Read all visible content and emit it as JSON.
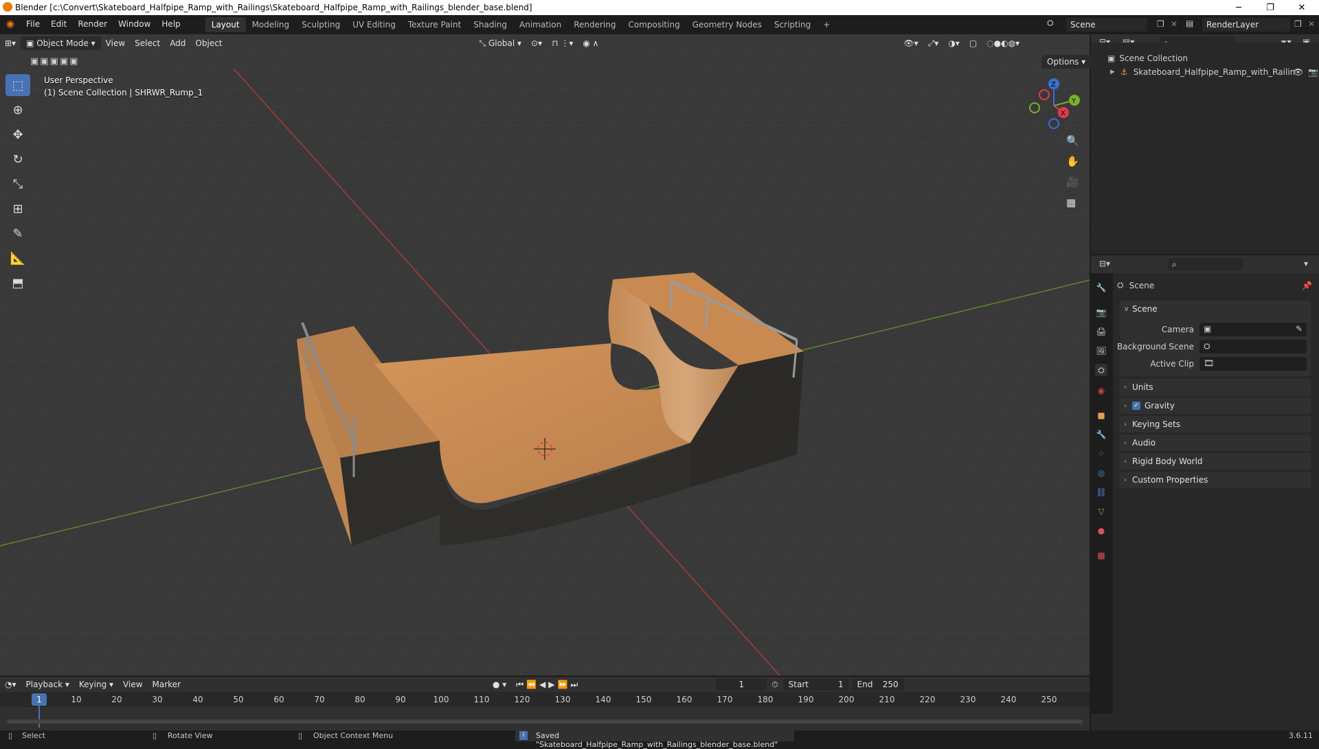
{
  "window": {
    "title": "Blender [c:\\Convert\\Skateboard_Halfpipe_Ramp_with_Railings\\Skateboard_Halfpipe_Ramp_with_Railings_blender_base.blend]",
    "controls": {
      "minimize": "─",
      "restore": "❐",
      "close": "✕"
    }
  },
  "menu": {
    "items": [
      "File",
      "Edit",
      "Render",
      "Window",
      "Help"
    ],
    "workspaces": [
      "Layout",
      "Modeling",
      "Sculpting",
      "UV Editing",
      "Texture Paint",
      "Shading",
      "Animation",
      "Rendering",
      "Compositing",
      "Geometry Nodes",
      "Scripting"
    ],
    "active_workspace": "Layout",
    "add_tab": "+",
    "scene_name": "Scene",
    "view_layer": "RenderLayer"
  },
  "viewport": {
    "mode": "Object Mode",
    "menus": [
      "View",
      "Select",
      "Add",
      "Object"
    ],
    "transform_orientation": "Global",
    "options_label": "Options",
    "overlay_line1": "User Perspective",
    "overlay_line2": "(1) Scene Collection | SHRWR_Rump_1",
    "gizmo": {
      "x": "X",
      "y": "Y",
      "z": "Z"
    },
    "colors": {
      "background": "#393939",
      "x_axis": "#a83a3a",
      "y_axis": "#5f8a2a",
      "ramp_wood": "#c98a52",
      "ramp_side": "#2f2d2a"
    }
  },
  "outliner": {
    "root": "Scene Collection",
    "items": [
      {
        "name": "Skateboard_Halfpipe_Ramp_with_Railin"
      }
    ]
  },
  "properties": {
    "header": "Scene",
    "section": "Scene",
    "fields": [
      {
        "label": "Camera",
        "value": ""
      },
      {
        "label": "Background Scene",
        "value": ""
      },
      {
        "label": "Active Clip",
        "value": ""
      }
    ],
    "panels": [
      {
        "label": "Units",
        "checkbox": false
      },
      {
        "label": "Gravity",
        "checkbox": true
      },
      {
        "label": "Keying Sets",
        "checkbox": false
      },
      {
        "label": "Audio",
        "checkbox": false
      },
      {
        "label": "Rigid Body World",
        "checkbox": false
      },
      {
        "label": "Custom Properties",
        "checkbox": false
      }
    ]
  },
  "timeline": {
    "menus": [
      "Playback",
      "Keying",
      "View",
      "Marker"
    ],
    "current_frame": "1",
    "start_label": "Start",
    "start": "1",
    "end_label": "End",
    "end": "250",
    "ticks": [
      "10",
      "20",
      "30",
      "40",
      "50",
      "60",
      "70",
      "80",
      "90",
      "100",
      "110",
      "120",
      "130",
      "140",
      "150",
      "160",
      "170",
      "180",
      "190",
      "200",
      "210",
      "220",
      "230",
      "240",
      "250"
    ],
    "playhead": "1"
  },
  "statusbar": {
    "select": "Select",
    "rotate": "Rotate View",
    "context": "Object Context Menu",
    "message": "Saved \"Skateboard_Halfpipe_Ramp_with_Railings_blender_base.blend\"",
    "version": "3.6.11"
  }
}
